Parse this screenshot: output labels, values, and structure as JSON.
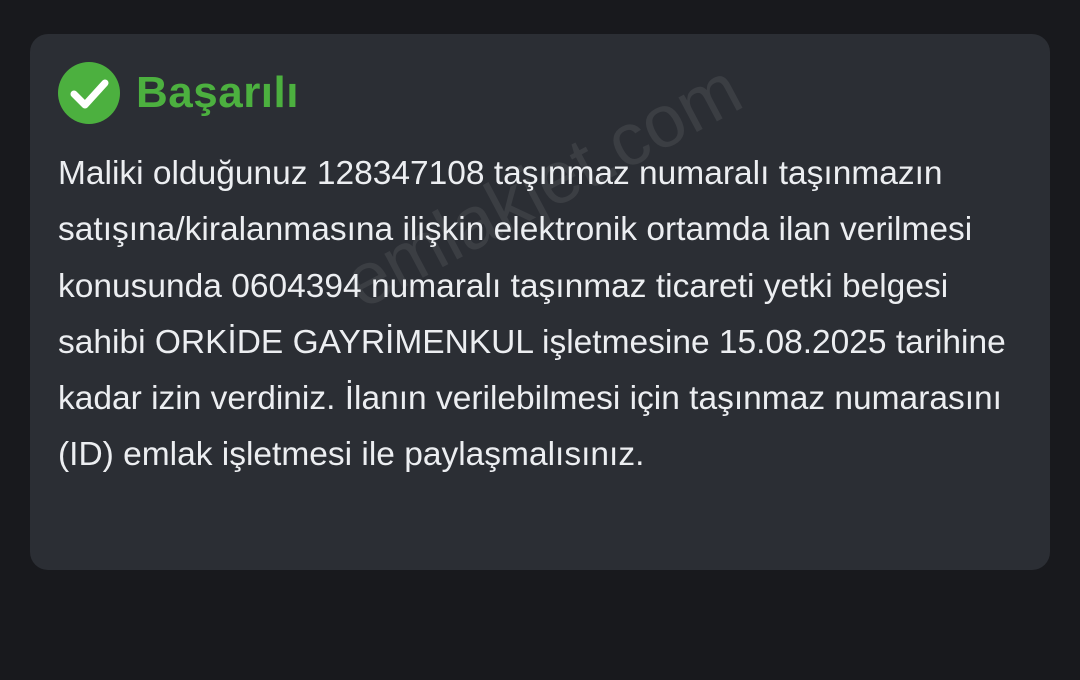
{
  "alert": {
    "title": "Başarılı",
    "icon": "check-circle-icon",
    "success_color": "#4cb03f",
    "message": "Maliki olduğunuz 128347108 taşınmaz numaralı taşınmazın satışına/kiralanmasına ilişkin elektronik ortamda ilan verilmesi konusunda 0604394 numaralı taşınmaz ticareti yetki belgesi sahibi ORKİDE GAYRİMENKUL işletmesine 15.08.2025 tarihine kadar izin verdiniz. İlanın verilebilmesi için taşınmaz numarasını (ID) emlak işletmesi ile paylaşmalısınız."
  },
  "watermark": {
    "text": "emlakjet.com"
  }
}
